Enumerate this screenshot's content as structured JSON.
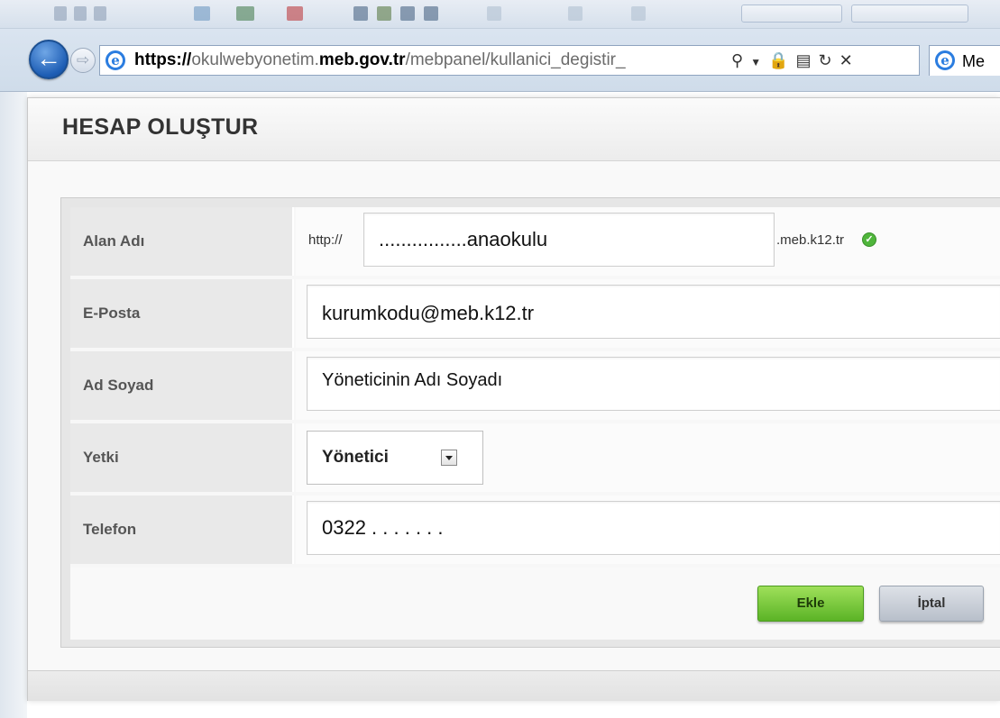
{
  "browser": {
    "url_prefix": "https://",
    "url_host_start": "okulwebyonetim.",
    "url_domain": "meb.gov.tr",
    "url_path": "/mebpanel/kullanici_degistir_",
    "tab_label": "Me"
  },
  "dialog": {
    "title": "HESAP OLUŞTUR"
  },
  "form": {
    "domain": {
      "label": "Alan Adı",
      "prefix": "http://",
      "value": "................anaokulu",
      "suffix": ".meb.k12.tr"
    },
    "email": {
      "label": "E-Posta",
      "value": "kurumkodu@meb.k12.tr"
    },
    "fullname": {
      "label": "Ad Soyad",
      "value": "Yöneticinin Adı Soyadı"
    },
    "role": {
      "label": "Yetki",
      "selected": "Yönetici"
    },
    "phone": {
      "label": "Telefon",
      "value": "0322 . . . . . . ."
    },
    "buttons": {
      "add": "Ekle",
      "cancel": "İptal"
    }
  },
  "colors": {
    "add_button": "#5bb326",
    "valid_icon": "#4fb53b",
    "back_button": "#1d5db4"
  }
}
